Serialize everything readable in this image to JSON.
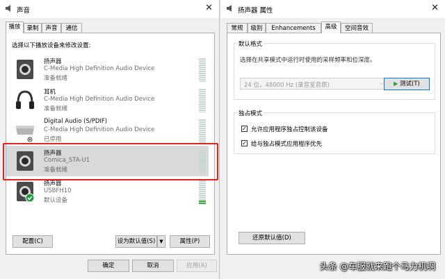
{
  "sound_window": {
    "title": "声音",
    "tabs": [
      "播放",
      "录制",
      "声音",
      "通信"
    ],
    "instruction": "选择以下播放设备来修改设置:",
    "devices": [
      {
        "name": "扬声器",
        "description": "C-Media High Definition Audio Device",
        "status": "准备就绪",
        "icon": "speaker-icon",
        "level_fraction": 0
      },
      {
        "name": "耳机",
        "description": "C-Media High Definition Audio Device",
        "status": "准备就绪",
        "icon": "headphones-icon",
        "level_fraction": 0
      },
      {
        "name": "Digital Audio (S/PDIF)",
        "description": "C-Media High Definition Audio Device",
        "status": "已停用",
        "icon": "digital-audio-icon",
        "level_fraction": 0
      },
      {
        "name": "扬声器",
        "description": "Comica_STA-U1",
        "status": "准备就绪",
        "icon": "speaker-icon",
        "level_fraction": 0,
        "selected": true
      },
      {
        "name": "扬声器",
        "description": "USBFH10",
        "status": "默认设备",
        "icon": "speaker-default-icon",
        "level_fraction": 0.15
      }
    ],
    "buttons": {
      "configure": "配置(C)",
      "set_default": "设为默认值(S)",
      "properties": "属性(P)",
      "ok": "确定",
      "cancel": "取消",
      "apply": "应用(A)"
    }
  },
  "props_window": {
    "title": "扬声器 属性",
    "tabs": [
      "常规",
      "级别",
      "Enhancements",
      "高级",
      "空间音效"
    ],
    "default_format": {
      "group_label": "默认格式",
      "description": "选择在共享模式中运行时使用的采样频率和位深度。",
      "selected_format": "24 位，48000 Hz (录音室音质)",
      "test_button": "测试(T)"
    },
    "exclusive_mode": {
      "group_label": "独占模式",
      "options": [
        {
          "label": "允许应用程序独占控制该设备",
          "checked": true
        },
        {
          "label": "给与独占模式应用程序优先",
          "checked": true
        }
      ]
    },
    "restore_button": "还原默认值(D)"
  },
  "watermark": "头条 @车服就来跑个马力机啊",
  "colors": {
    "highlight_box": "#e4211d",
    "selection": "#d9d9d9",
    "meter": "#c3d7d7",
    "meter_level": "#3cb33c",
    "default_badge": "#1f9c3a"
  }
}
